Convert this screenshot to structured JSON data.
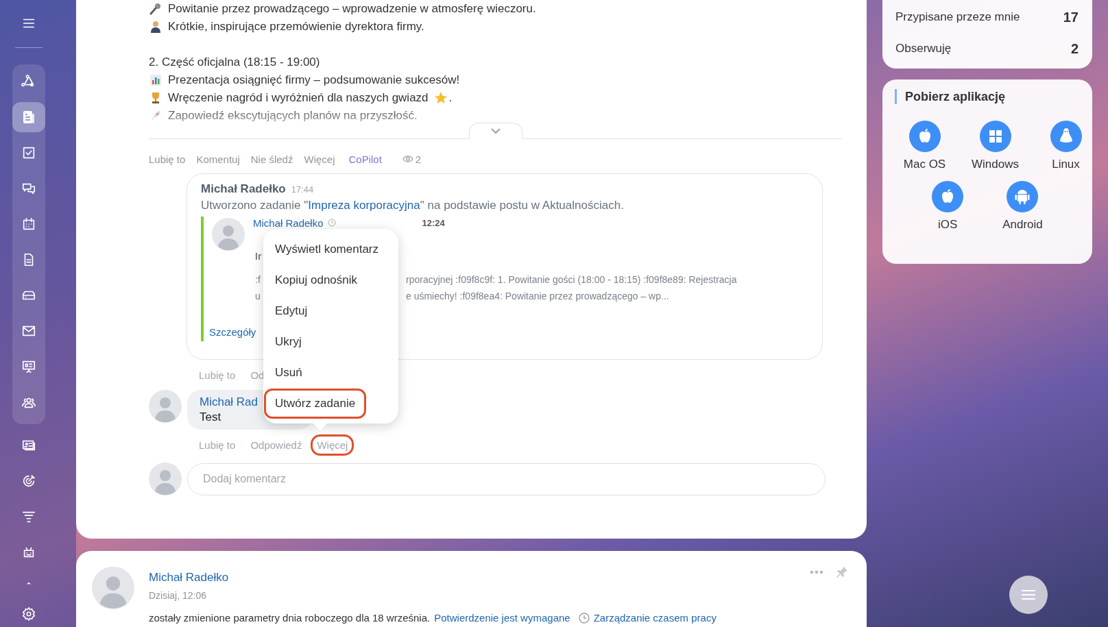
{
  "sidebar": {
    "pinned_items": [
      {
        "kind": "share",
        "selected": false
      },
      {
        "kind": "news",
        "selected": true
      },
      {
        "kind": "tasks",
        "selected": false
      },
      {
        "kind": "chat",
        "selected": false
      },
      {
        "kind": "calendar",
        "selected": false
      },
      {
        "kind": "document",
        "selected": false
      },
      {
        "kind": "drive",
        "selected": false
      },
      {
        "kind": "mail",
        "selected": false
      },
      {
        "kind": "presentation",
        "selected": false
      },
      {
        "kind": "people",
        "selected": false
      }
    ],
    "items": [
      {
        "kind": "contact-card",
        "selected": false
      },
      {
        "kind": "target",
        "selected": false
      },
      {
        "kind": "filter",
        "selected": false
      },
      {
        "kind": "robot",
        "selected": false
      },
      {
        "kind": "caret",
        "selected": false
      },
      {
        "kind": "settings",
        "selected": false
      }
    ]
  },
  "post": {
    "collapsed": true,
    "lines": [
      {
        "kind": "mic",
        "text": "Powitanie przez prowadzącego – wprowadzenie w atmosferę wieczoru."
      },
      {
        "kind": "person",
        "text": "Krótkie, inspirujące przemówienie dyrektora firmy."
      },
      {
        "kind": "gap"
      },
      {
        "kind": "heading",
        "text": "2. Część oficjalna (18:15 - 19:00)"
      },
      {
        "kind": "chart",
        "text": "Prezentacja osiągnięć firmy – podsumowanie sukcesów!"
      },
      {
        "kind": "trophy",
        "text": "Wręczenie nagród i wyróżnień dla naszych gwiazd",
        "trail_text": "."
      },
      {
        "kind": "rocket",
        "text": "Zapowiedź ekscytujących planów na przyszłość."
      }
    ],
    "actions": [
      {
        "label": "Lubię to",
        "kind": "plain"
      },
      {
        "label": "Komentuj",
        "kind": "plain"
      },
      {
        "label": "Nie śledź",
        "kind": "plain"
      },
      {
        "label": "Więcej",
        "kind": "plain"
      },
      {
        "label": "CoPilot",
        "kind": "copilot"
      }
    ],
    "views": "2",
    "comments": [
      {
        "kind": "task-note",
        "author": "Michał Radełko",
        "time": "17:44",
        "text_before": "Utworzono zadanie \"",
        "link": "Impreza korporacyjna",
        "text_after": "\" na podstawie postu w Aktualnościach.",
        "quote": {
          "author": "Michał Radełko",
          "time": "12:24",
          "rows": [
            {
              "kind": "title",
              "left": "Ir"
            },
            {
              "kind": "body",
              "left": ":f",
              "right": "rporacyjnej :f09f8c9f: 1. Powitanie gości (18:00 - 18:15) :f09f8e89: Rejestracja"
            },
            {
              "kind": "body",
              "left": "u",
              "right": "e uśmiechy! :f09f8ea4: Powitanie przez prowadzącego – wp..."
            }
          ],
          "details_link": "Szczegóły"
        },
        "actions": [
          {
            "label": "Lubię to",
            "highlighted": false
          },
          {
            "label": "Od",
            "highlighted": false
          }
        ]
      },
      {
        "kind": "bubble",
        "author": "Michał Rad",
        "text": "Test",
        "actions": [
          {
            "label": "Lubię to",
            "highlighted": false
          },
          {
            "label": "Odpowiedź",
            "highlighted": false
          },
          {
            "label": "Więcej",
            "highlighted": true
          }
        ]
      }
    ],
    "comment_field": {
      "placeholder": "Dodaj komentarz"
    },
    "context_menu": {
      "items": [
        {
          "label": "Wyświetl komentarz",
          "highlighted": false
        },
        {
          "label": "Kopiuj odnośnik",
          "highlighted": false
        },
        {
          "label": "Edytuj",
          "highlighted": false
        },
        {
          "label": "Ukryj",
          "highlighted": false
        },
        {
          "label": "Usuń",
          "highlighted": false
        },
        {
          "label": "Utwórz zadanie",
          "highlighted": true
        }
      ]
    }
  },
  "second_post": {
    "author": "Michał Radełko",
    "date": "Dzisiaj, 12:06",
    "text": "zostały zmienione parametry dnia roboczego dla 18 września.",
    "link": "Potwierdzenie jest wymagane",
    "link2": "Zarządzanie czasem pracy"
  },
  "counters": [
    {
      "label": "Przypisane przeze mnie",
      "value": "17"
    },
    {
      "label": "Obserwuję",
      "value": "2"
    }
  ],
  "apps": {
    "title": "Pobierz aplikację",
    "items": [
      {
        "kind": "apple",
        "label": "Mac OS"
      },
      {
        "kind": "windows",
        "label": "Windows"
      },
      {
        "kind": "linux",
        "label": "Linux"
      },
      {
        "kind": "apple",
        "label": "iOS"
      },
      {
        "kind": "android",
        "label": "Android"
      }
    ]
  }
}
